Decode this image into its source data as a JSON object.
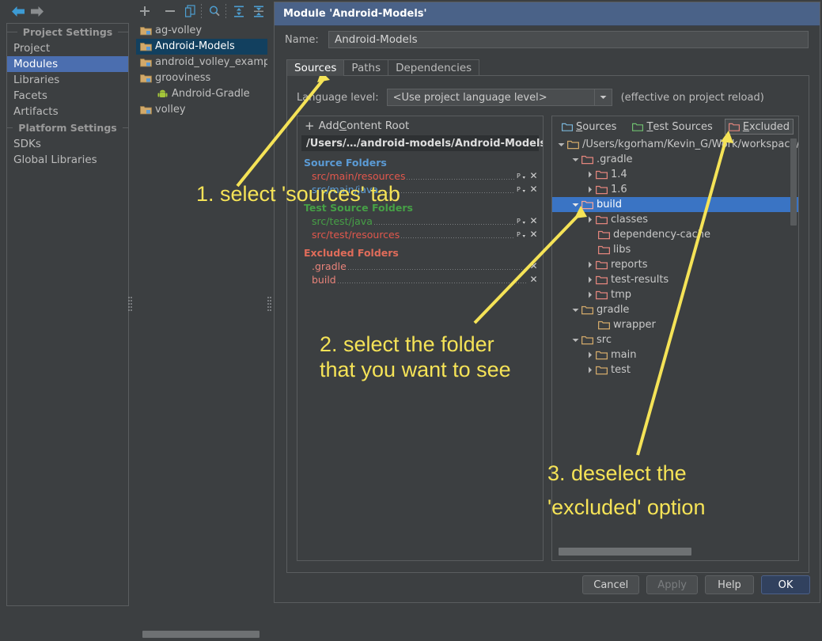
{
  "toolbar": {
    "back_icon": "back-arrow-icon",
    "forward_icon": "forward-arrow-icon",
    "add_icon": "plus-icon",
    "remove_icon": "minus-icon",
    "copy_icon": "copy-icon",
    "find_icon": "search-icon",
    "expand_all_icon": "expand-all-icon",
    "collapse_all_icon": "collapse-all-icon"
  },
  "sidebar": {
    "groups": [
      {
        "title": "Project Settings",
        "items": [
          {
            "label": "Project",
            "selected": false
          },
          {
            "label": "Modules",
            "selected": true
          },
          {
            "label": "Libraries",
            "selected": false
          },
          {
            "label": "Facets",
            "selected": false
          },
          {
            "label": "Artifacts",
            "selected": false
          }
        ]
      },
      {
        "title": "Platform Settings",
        "items": [
          {
            "label": "SDKs",
            "selected": false
          },
          {
            "label": "Global Libraries",
            "selected": false
          }
        ]
      }
    ]
  },
  "modules": {
    "items": [
      {
        "label": "ag-volley",
        "selected": false,
        "indent": false,
        "icon": "module-folder-icon"
      },
      {
        "label": "Android-Models",
        "selected": true,
        "indent": false,
        "icon": "module-folder-icon"
      },
      {
        "label": "android_volley_examples",
        "selected": false,
        "indent": false,
        "icon": "module-folder-icon"
      },
      {
        "label": "grooviness",
        "selected": false,
        "indent": false,
        "icon": "module-folder-icon"
      },
      {
        "label": "Android-Gradle",
        "selected": false,
        "indent": true,
        "icon": "android-facet-icon"
      },
      {
        "label": "volley",
        "selected": false,
        "indent": false,
        "icon": "module-folder-icon"
      }
    ]
  },
  "dialog": {
    "title": "Module 'Android-Models'",
    "name_label": "Name:",
    "name_value": "Android-Models",
    "tabs": [
      {
        "label": "Sources",
        "active": true
      },
      {
        "label": "Paths",
        "active": false
      },
      {
        "label": "Dependencies",
        "active": false
      }
    ],
    "language_level_label": "Language level:",
    "language_level_value": "<Use project language level>",
    "language_level_note": "(effective on project reload)",
    "buttons": {
      "cancel": "Cancel",
      "apply": "Apply",
      "help": "Help",
      "ok": "OK"
    }
  },
  "content_roots": {
    "add_label_pre": "Add ",
    "add_label_key": "C",
    "add_label_post": "ontent Root",
    "root_path": "/Users/…/android-models/Android-Models",
    "sections": [
      {
        "title": "Source Folders",
        "color_class": "src",
        "folders": [
          {
            "name": "src/main/resources",
            "color": "c-red",
            "has_pkg": true
          },
          {
            "name": "src/main/java",
            "color": "c-blue",
            "has_pkg": true
          }
        ]
      },
      {
        "title": "Test Source Folders",
        "color_class": "test",
        "folders": [
          {
            "name": "src/test/java",
            "color": "c-green",
            "has_pkg": true
          },
          {
            "name": "src/test/resources",
            "color": "c-red",
            "has_pkg": true
          }
        ]
      },
      {
        "title": "Excluded Folders",
        "color_class": "excl",
        "folders": [
          {
            "name": ".gradle",
            "color": "c-salmon",
            "has_pkg": false
          },
          {
            "name": "build",
            "color": "c-salmon",
            "has_pkg": false
          }
        ]
      }
    ]
  },
  "mark_bar": {
    "buttons": [
      {
        "key": "S",
        "rest": "ources",
        "icon": "folder-sources-icon",
        "color": "#7ab6d9",
        "active": false
      },
      {
        "key": "T",
        "rest": "est Sources",
        "icon": "folder-test-sources-icon",
        "color": "#6fbf6f",
        "active": false
      },
      {
        "key": "E",
        "rest": "xcluded",
        "icon": "folder-excluded-icon",
        "color": "#e2857c",
        "active": true
      }
    ]
  },
  "tree": {
    "nodes": [
      {
        "label": "/Users/kgorham/Kevin_G/Work/workspace/dev",
        "depth": 0,
        "twisty": "down",
        "folder": "tan",
        "selected": false
      },
      {
        "label": ".gradle",
        "depth": 1,
        "twisty": "down",
        "folder": "salmon",
        "selected": false
      },
      {
        "label": "1.4",
        "depth": 2,
        "twisty": "right",
        "folder": "salmon",
        "selected": false
      },
      {
        "label": "1.6",
        "depth": 2,
        "twisty": "right",
        "folder": "salmon",
        "selected": false
      },
      {
        "label": "build",
        "depth": 1,
        "twisty": "down",
        "folder": "salmon",
        "selected": true
      },
      {
        "label": "classes",
        "depth": 2,
        "twisty": "right",
        "folder": "salmon",
        "selected": false
      },
      {
        "label": "dependency-cache",
        "depth": 2,
        "twisty": "none",
        "folder": "salmon",
        "selected": false
      },
      {
        "label": "libs",
        "depth": 2,
        "twisty": "none",
        "folder": "salmon",
        "selected": false
      },
      {
        "label": "reports",
        "depth": 2,
        "twisty": "right",
        "folder": "salmon",
        "selected": false
      },
      {
        "label": "test-results",
        "depth": 2,
        "twisty": "right",
        "folder": "salmon",
        "selected": false
      },
      {
        "label": "tmp",
        "depth": 2,
        "twisty": "right",
        "folder": "salmon",
        "selected": false
      },
      {
        "label": "gradle",
        "depth": 1,
        "twisty": "down",
        "folder": "tan",
        "selected": false
      },
      {
        "label": "wrapper",
        "depth": 2,
        "twisty": "none",
        "folder": "tan",
        "selected": false
      },
      {
        "label": "src",
        "depth": 1,
        "twisty": "down",
        "folder": "tan",
        "selected": false
      },
      {
        "label": "main",
        "depth": 2,
        "twisty": "right",
        "folder": "tan",
        "selected": false
      },
      {
        "label": "test",
        "depth": 2,
        "twisty": "right",
        "folder": "tan",
        "selected": false
      }
    ]
  },
  "annotations": {
    "color": "#f5e357",
    "items": [
      {
        "id": "step1",
        "text": "1. select 'sources' tab"
      },
      {
        "id": "step2line1",
        "text": "2. select the folder"
      },
      {
        "id": "step2line2",
        "text": "that you want to see"
      },
      {
        "id": "step3line1",
        "text": "3. deselect the"
      },
      {
        "id": "step3line2",
        "text": "'excluded' option"
      }
    ]
  }
}
